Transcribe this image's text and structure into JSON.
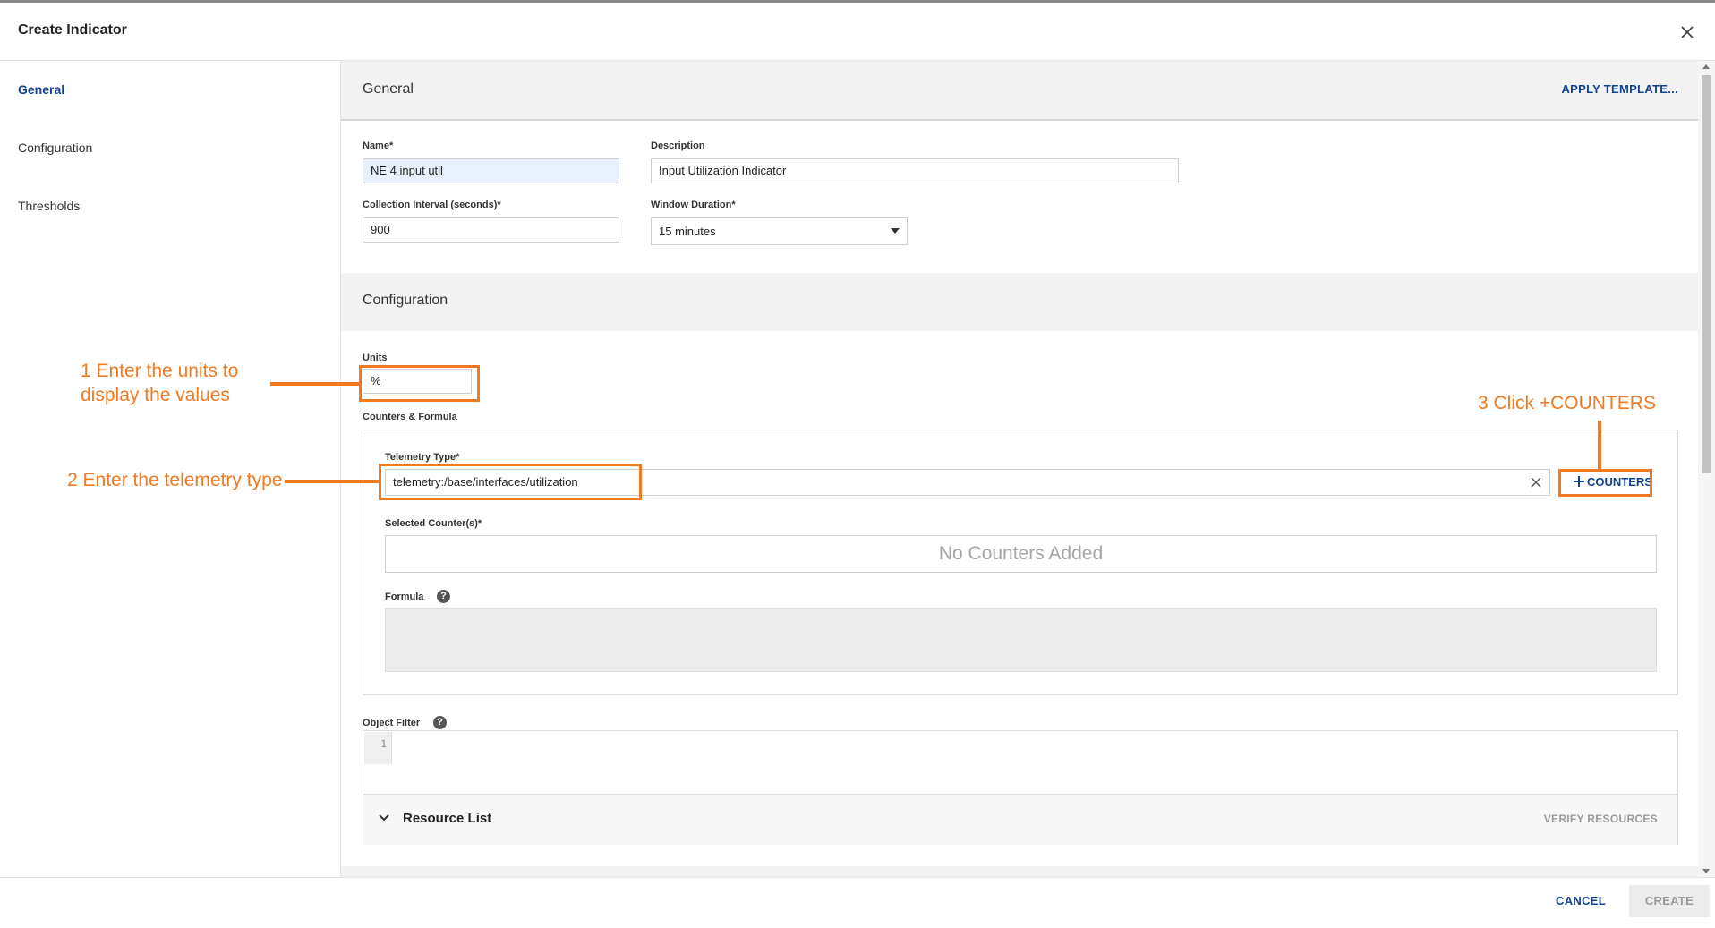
{
  "dialog": {
    "title": "Create Indicator"
  },
  "sidebar": {
    "items": [
      {
        "label": "General",
        "active": true
      },
      {
        "label": "Configuration",
        "active": false
      },
      {
        "label": "Thresholds",
        "active": false
      }
    ]
  },
  "general": {
    "heading": "General",
    "apply_template": "APPLY TEMPLATE...",
    "name": {
      "label": "Name*",
      "value": "NE 4 input util"
    },
    "description": {
      "label": "Description",
      "value": "Input Utilization Indicator"
    },
    "collection_interval": {
      "label": "Collection Interval (seconds)*",
      "value": "900"
    },
    "window_duration": {
      "label": "Window Duration*",
      "value": "15 minutes"
    }
  },
  "configuration": {
    "heading": "Configuration",
    "units": {
      "label": "Units",
      "value": "%"
    },
    "counters_formula_label": "Counters & Formula",
    "telemetry_type": {
      "label": "Telemetry Type*",
      "value": "telemetry:/base/interfaces/utilization"
    },
    "add_counters": "COUNTERS",
    "selected_counters": {
      "label": "Selected Counter(s)*",
      "empty_text": "No Counters Added"
    },
    "formula": {
      "label": "Formula",
      "help": "?"
    },
    "object_filter": {
      "label": "Object Filter",
      "help": "?",
      "line_number": "1"
    },
    "resource_list": {
      "label": "Resource List",
      "verify": "VERIFY RESOURCES"
    }
  },
  "annotations": {
    "step1": [
      "1 Enter the units to",
      "display the values"
    ],
    "step2": "2 Enter the telemetry type",
    "step3": "3 Click +COUNTERS"
  },
  "footer": {
    "cancel": "CANCEL",
    "create": "CREATE"
  },
  "colors": {
    "accent": "#124191",
    "annotation": "#f07a22"
  }
}
